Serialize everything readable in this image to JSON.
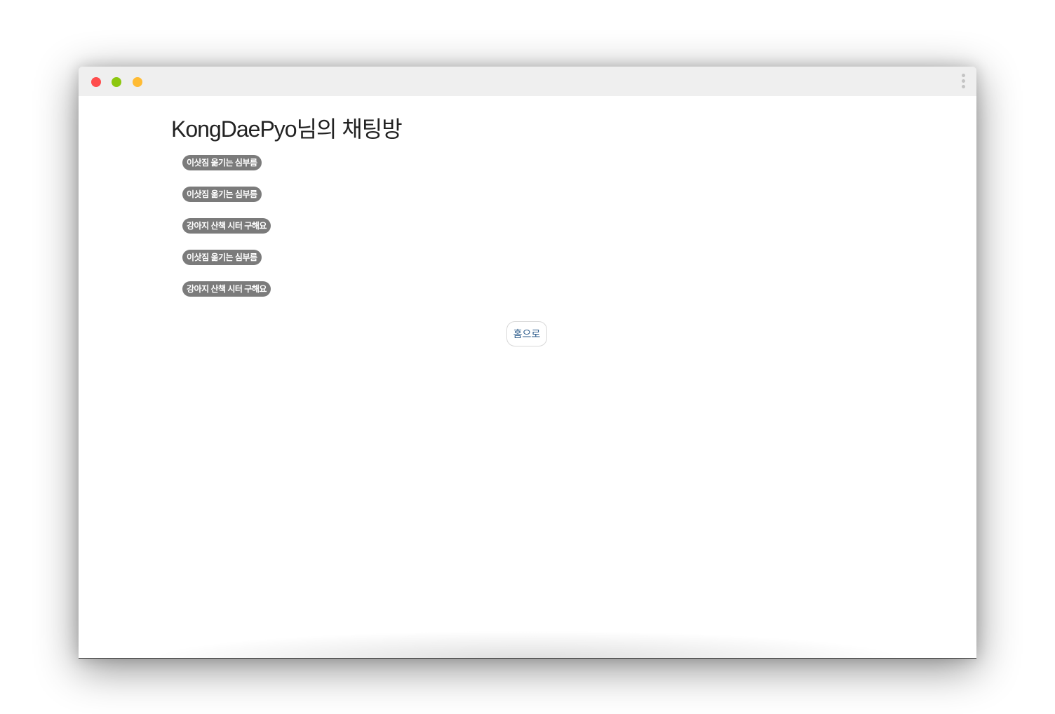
{
  "window": {
    "controls": {
      "close_color": "#ff4d4d",
      "minimize_color": "#8cc70f",
      "maximize_color": "#ffbb33"
    },
    "menu_icon": "kebab-vertical-icon"
  },
  "page": {
    "title": "KongDaePyo님의 채팅방",
    "rooms": [
      {
        "label": "이삿짐 옮기는 심부름"
      },
      {
        "label": "이삿짐 옮기는 심부름"
      },
      {
        "label": "강아지 산책 시터 구해요"
      },
      {
        "label": "이삿짐 옮기는 심부름"
      },
      {
        "label": "강아지 산책 시터 구해요"
      }
    ],
    "home_button_label": "홈으로"
  }
}
